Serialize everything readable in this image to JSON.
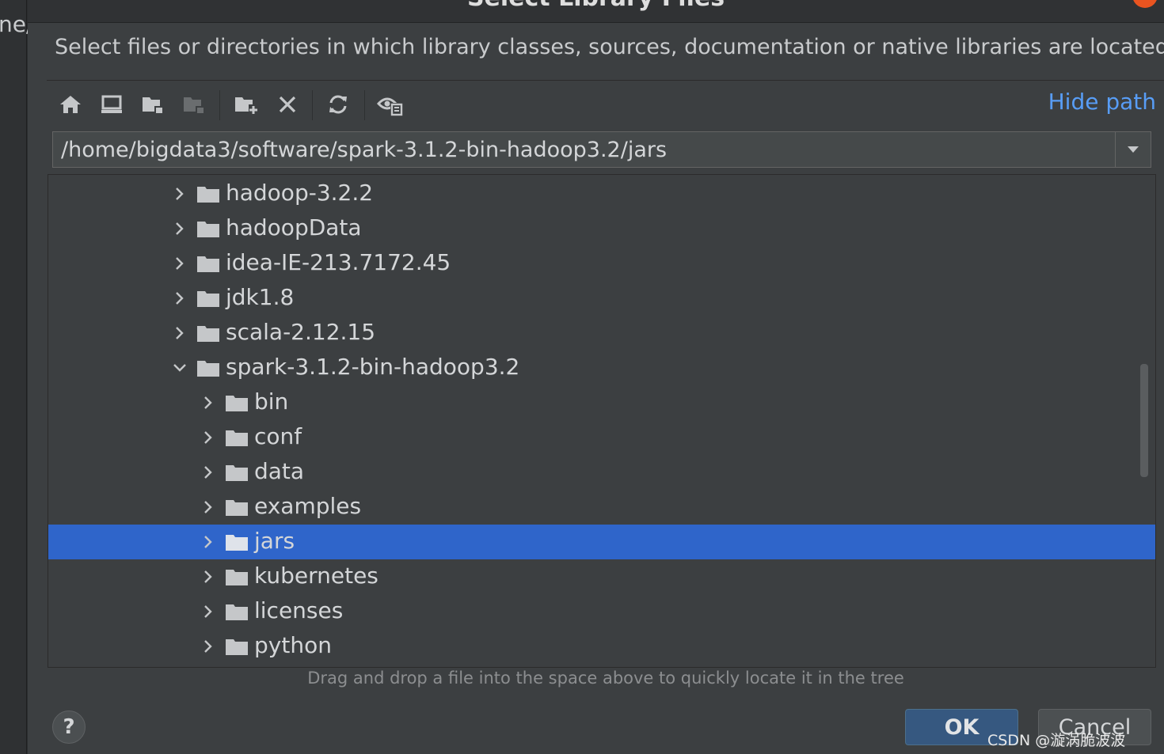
{
  "background": {
    "fragment_text": "ne/"
  },
  "dialog": {
    "title": "Select Library Files",
    "description": "Select files or directories in which library classes, sources, documentation or native libraries are located",
    "hide_path_label": "Hide path",
    "path_value": "/home/bigdata3/software/spark-3.1.2-bin-hadoop3.2/jars",
    "hint": "Drag and drop a file into the space above to quickly locate it in the tree",
    "help_label": "?",
    "ok_label": "OK",
    "cancel_label": "Cancel"
  },
  "toolbar": {
    "buttons": [
      {
        "name": "home-directory-button",
        "icon": "home-icon"
      },
      {
        "name": "desktop-directory-button",
        "icon": "desktop-icon"
      },
      {
        "name": "project-directory-button",
        "icon": "project-folder-icon"
      },
      {
        "name": "module-directory-button",
        "icon": "module-folder-icon",
        "disabled": true
      },
      {
        "name": "new-folder-button",
        "icon": "new-folder-icon"
      },
      {
        "name": "delete-button",
        "icon": "delete-icon"
      },
      {
        "name": "refresh-button",
        "icon": "refresh-icon"
      },
      {
        "name": "show-hidden-files-button",
        "icon": "show-hidden-icon"
      }
    ]
  },
  "tree": {
    "items": [
      {
        "label": "hadoop-3.2.2",
        "depth": 0,
        "expanded": false,
        "selected": false
      },
      {
        "label": "hadoopData",
        "depth": 0,
        "expanded": false,
        "selected": false
      },
      {
        "label": "idea-IE-213.7172.45",
        "depth": 0,
        "expanded": false,
        "selected": false
      },
      {
        "label": "jdk1.8",
        "depth": 0,
        "expanded": false,
        "selected": false
      },
      {
        "label": "scala-2.12.15",
        "depth": 0,
        "expanded": false,
        "selected": false
      },
      {
        "label": "spark-3.1.2-bin-hadoop3.2",
        "depth": 0,
        "expanded": true,
        "selected": false
      },
      {
        "label": "bin",
        "depth": 1,
        "expanded": false,
        "selected": false
      },
      {
        "label": "conf",
        "depth": 1,
        "expanded": false,
        "selected": false
      },
      {
        "label": "data",
        "depth": 1,
        "expanded": false,
        "selected": false
      },
      {
        "label": "examples",
        "depth": 1,
        "expanded": false,
        "selected": false
      },
      {
        "label": "jars",
        "depth": 1,
        "expanded": false,
        "selected": true
      },
      {
        "label": "kubernetes",
        "depth": 1,
        "expanded": false,
        "selected": false
      },
      {
        "label": "licenses",
        "depth": 1,
        "expanded": false,
        "selected": false
      },
      {
        "label": "python",
        "depth": 1,
        "expanded": false,
        "selected": false
      }
    ]
  },
  "watermark": "CSDN @漩涡脆波波",
  "colors": {
    "dialog_bg": "#3c3f41",
    "selection": "#2f65ca",
    "link": "#589df6",
    "text": "#d4d6d8",
    "folder": "#c5c7c9",
    "ok_button": "#365880"
  }
}
